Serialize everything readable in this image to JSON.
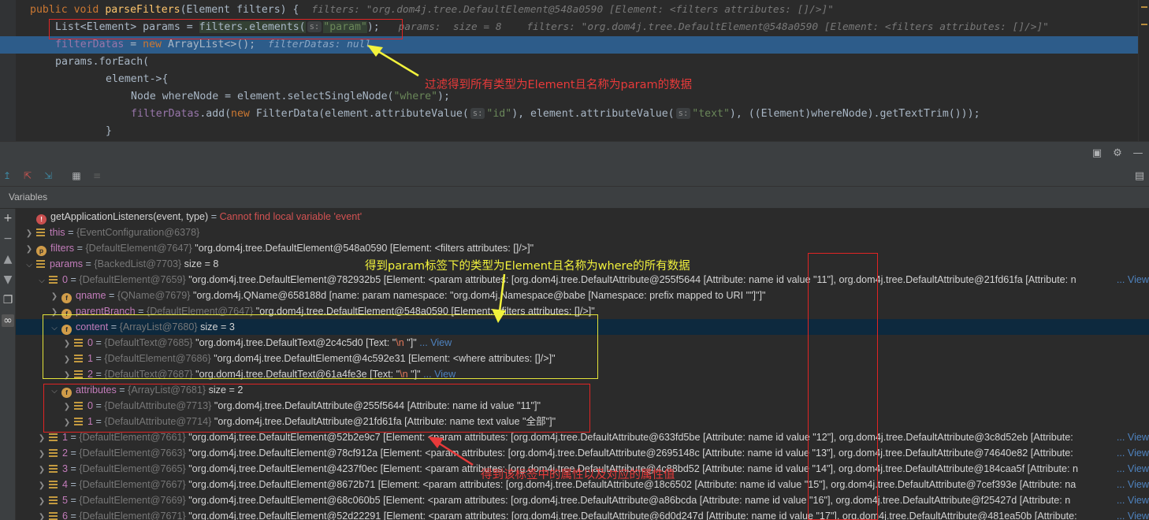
{
  "editor": {
    "line1": {
      "kw1": "public",
      "kw2": "void",
      "method": "parseFilters",
      "open": "(",
      "type": "Element",
      "param": " filters) {",
      "hint": "filters: \"org.dom4j.tree.DefaultElement@548a0590 [Element: <filters attributes: []/>]\""
    },
    "line2": {
      "decl": "List<Element> params = ",
      "call": "filters.elements(",
      "chip": "s:",
      "arg": "\"param\"",
      "close": ");",
      "hint1": "params:  size = 8",
      "hint2": "filters: \"org.dom4j.tree.DefaultElement@548a0590 [Element: <filters attributes: []/>]\""
    },
    "line3": {
      "field": "filterDatas",
      "eq": " = ",
      "kw": "new",
      "rest": " ArrayList<>();",
      "hint": "filterDatas: null"
    },
    "line4": {
      "text": "params.forEach("
    },
    "line5": {
      "text": "element->{"
    },
    "line6": {
      "decl": "Node whereNode = element.selectSingleNode(",
      "arg": "\"where\"",
      "close": ");"
    },
    "line7": {
      "field": "filterDatas",
      "mid1": ".add(",
      "kw": "new",
      "mid2": " FilterData(element.attributeValue(",
      "chip1": "s:",
      "arg1": "\"id\"",
      "mid3": "), element.attributeValue(",
      "chip2": "s:",
      "arg2": "\"text\"",
      "mid4": "), ((Element)whereNode).getTextTrim()));"
    },
    "line8": {
      "text": "}"
    }
  },
  "debug": {
    "vars_title": "Variables",
    "rows": [
      {
        "name": "getApplicationListeners(event, type)",
        "eq": " = ",
        "err": "Cannot find local variable 'event'"
      },
      {
        "name": "this",
        "eq": " = ",
        "type": "{EventConfiguration@6378}",
        "val": ""
      },
      {
        "name": "filters",
        "eq": " = ",
        "type": "{DefaultElement@7647}",
        "val": " \"org.dom4j.tree.DefaultElement@548a0590 [Element: <filters attributes: []/>]\""
      },
      {
        "name": "params",
        "eq": " = ",
        "type": "{BackedList@7703}",
        "val": "  size = 8"
      },
      {
        "name": "0",
        "eq": " = ",
        "type": "{DefaultElement@7659}",
        "val": " \"org.dom4j.tree.DefaultElement@782932b5 [Element: <param attributes: [org.dom4j.tree.DefaultAttribute@255f5644 [Attribute: name id value \"11\"], org.dom4j.tree.DefaultAttribute@21fd61fa [Attribute: n",
        "view": "... View"
      },
      {
        "name": "qname",
        "eq": " = ",
        "type": "{QName@7679}",
        "val": " \"org.dom4j.QName@658188d [name: param namespace: \"org.dom4j.Namespace@babe [Namespace: prefix  mapped to URI \"\"]\"]\""
      },
      {
        "name": "parentBranch",
        "eq": " = ",
        "type": "{DefaultElement@7647}",
        "val": " \"org.dom4j.tree.DefaultElement@548a0590 [Element: <filters attributes: []/>]\""
      },
      {
        "name": "content",
        "eq": " = ",
        "type": "{ArrayList@7680}",
        "val": "  size = 3"
      },
      {
        "name": "0",
        "eq": " = ",
        "type": "{DefaultText@7685}",
        "val": " \"org.dom4j.tree.DefaultText@2c4c5d0 [Text: \"",
        "esc": "\\n",
        "val2": "            \"]\"",
        "view": " ... View"
      },
      {
        "name": "1",
        "eq": " = ",
        "type": "{DefaultElement@7686}",
        "val": " \"org.dom4j.tree.DefaultElement@4c592e31 [Element: <where attributes: []/>]\""
      },
      {
        "name": "2",
        "eq": " = ",
        "type": "{DefaultText@7687}",
        "val": " \"org.dom4j.tree.DefaultText@61a4fe3e [Text: \"",
        "esc": "\\n",
        "val2": "         \"]\"",
        "view": " ... View"
      },
      {
        "name": "attributes",
        "eq": " = ",
        "type": "{ArrayList@7681}",
        "val": "  size = 2"
      },
      {
        "name": "0",
        "eq": " = ",
        "type": "{DefaultAttribute@7713}",
        "val": " \"org.dom4j.tree.DefaultAttribute@255f5644 [Attribute: name id value \"11\"]\""
      },
      {
        "name": "1",
        "eq": " = ",
        "type": "{DefaultAttribute@7714}",
        "val": " \"org.dom4j.tree.DefaultAttribute@21fd61fa [Attribute: name text value \"全部\"]\""
      },
      {
        "name": "1",
        "eq": " = ",
        "type": "{DefaultElement@7661}",
        "val": " \"org.dom4j.tree.DefaultElement@52b2e9c7 [Element: <param attributes: [org.dom4j.tree.DefaultAttribute@633fd5be [Attribute: name id value \"12\"], org.dom4j.tree.DefaultAttribute@3c8d52eb [Attribute: ",
        "view": "... View"
      },
      {
        "name": "2",
        "eq": " = ",
        "type": "{DefaultElement@7663}",
        "val": " \"org.dom4j.tree.DefaultElement@78cf912a [Element: <param attributes: [org.dom4j.tree.DefaultAttribute@2695148c [Attribute: name id value \"13\"], org.dom4j.tree.DefaultAttribute@74640e82 [Attribute: ",
        "view": "... View"
      },
      {
        "name": "3",
        "eq": " = ",
        "type": "{DefaultElement@7665}",
        "val": " \"org.dom4j.tree.DefaultElement@4237f0ec [Element: <param attributes: [org.dom4j.tree.DefaultAttribute@4c88bd52 [Attribute: name id value \"14\"], org.dom4j.tree.DefaultAttribute@184caa5f [Attribute: n",
        "view": "... View"
      },
      {
        "name": "4",
        "eq": " = ",
        "type": "{DefaultElement@7667}",
        "val": " \"org.dom4j.tree.DefaultElement@8672b71 [Element: <param attributes: [org.dom4j.tree.DefaultAttribute@18c6502 [Attribute: name id value \"15\"], org.dom4j.tree.DefaultAttribute@7cef393e [Attribute: na",
        "view": "... View"
      },
      {
        "name": "5",
        "eq": " = ",
        "type": "{DefaultElement@7669}",
        "val": " \"org.dom4j.tree.DefaultElement@68c060b5 [Element: <param attributes: [org.dom4j.tree.DefaultAttribute@a86bcda [Attribute: name id value \"16\"], org.dom4j.tree.DefaultAttribute@f25427d [Attribute: n",
        "view": "... View"
      },
      {
        "name": "6",
        "eq": " = ",
        "type": "{DefaultElement@7671}",
        "val": " \"org.dom4j.tree.DefaultElement@52d22291 [Element: <param attributes: [org.dom4j.tree.DefaultAttribute@6d0d247d [Attribute: name id value \"17\"], org.dom4j.tree.DefaultAttribute@481ea50b [Attribute: ",
        "view": "... View"
      }
    ]
  },
  "annotations": {
    "note1": "过滤得到所有类型为Element且名称为param的数据",
    "note2": "得到param标签下的类型为Element且名称为where的所有数据",
    "note3": "得到该标签中的属性以及对应的属性值"
  },
  "colors": {
    "accent_red": "#e02424",
    "accent_yellow": "#e3e33a",
    "selection": "#2d5c8a"
  }
}
